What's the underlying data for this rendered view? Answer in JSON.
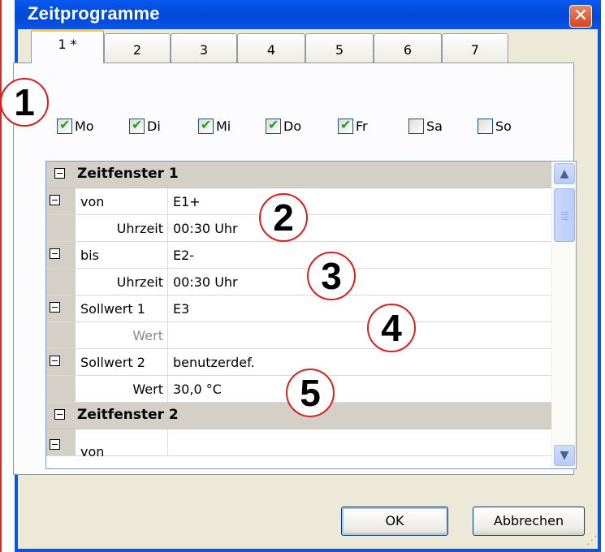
{
  "window": {
    "title": "Zeitprogramme",
    "close_glyph": "✕"
  },
  "tabs": [
    {
      "label": "1 *",
      "active": true
    },
    {
      "label": "2",
      "active": false
    },
    {
      "label": "3",
      "active": false
    },
    {
      "label": "4",
      "active": false
    },
    {
      "label": "5",
      "active": false
    },
    {
      "label": "6",
      "active": false
    },
    {
      "label": "7",
      "active": false
    }
  ],
  "days": [
    {
      "label": "Mo",
      "checked": true
    },
    {
      "label": "Di",
      "checked": true
    },
    {
      "label": "Mi",
      "checked": true
    },
    {
      "label": "Do",
      "checked": true
    },
    {
      "label": "Fr",
      "checked": true
    },
    {
      "label": "Sa",
      "checked": false
    },
    {
      "label": "So",
      "checked": false
    }
  ],
  "grid": {
    "rows": [
      {
        "type": "header",
        "text": "Zeitfenster 1"
      },
      {
        "type": "item",
        "name": "von",
        "value": "E1+"
      },
      {
        "type": "sub",
        "name": "Uhrzeit",
        "value": "00:30 Uhr"
      },
      {
        "type": "item",
        "name": "bis",
        "value": "E2-"
      },
      {
        "type": "sub",
        "name": "Uhrzeit",
        "value": "00:30 Uhr"
      },
      {
        "type": "item",
        "name": "Sollwert 1",
        "value": "E3"
      },
      {
        "type": "sub-disabled",
        "name": "Wert",
        "value": ""
      },
      {
        "type": "item",
        "name": "Sollwert 2",
        "value": "benutzerdef."
      },
      {
        "type": "sub",
        "name": "Wert",
        "value": "30,0 °C"
      },
      {
        "type": "header",
        "text": "Zeitfenster 2"
      },
      {
        "type": "item",
        "name": "von",
        "value": ""
      }
    ],
    "scroll_up_glyph": "▲",
    "scroll_down_glyph": "▼"
  },
  "callouts": [
    "1",
    "2",
    "3",
    "4",
    "5"
  ],
  "buttons": {
    "ok": "OK",
    "cancel": "Abbrechen"
  },
  "colors": {
    "titlebar": "#0a55e2",
    "client": "#ece9d8",
    "header_row": "#d4d0c8",
    "checkmark": "#21a121",
    "callout_border": "#d81f1f",
    "active_tab_accent": "#ffc83c"
  },
  "icons": {
    "close": "close-icon",
    "checkbox_tick": "checkmark-icon",
    "expander": "collapse-icon",
    "scroll_up": "arrow-up-icon",
    "scroll_down": "arrow-down-icon"
  }
}
